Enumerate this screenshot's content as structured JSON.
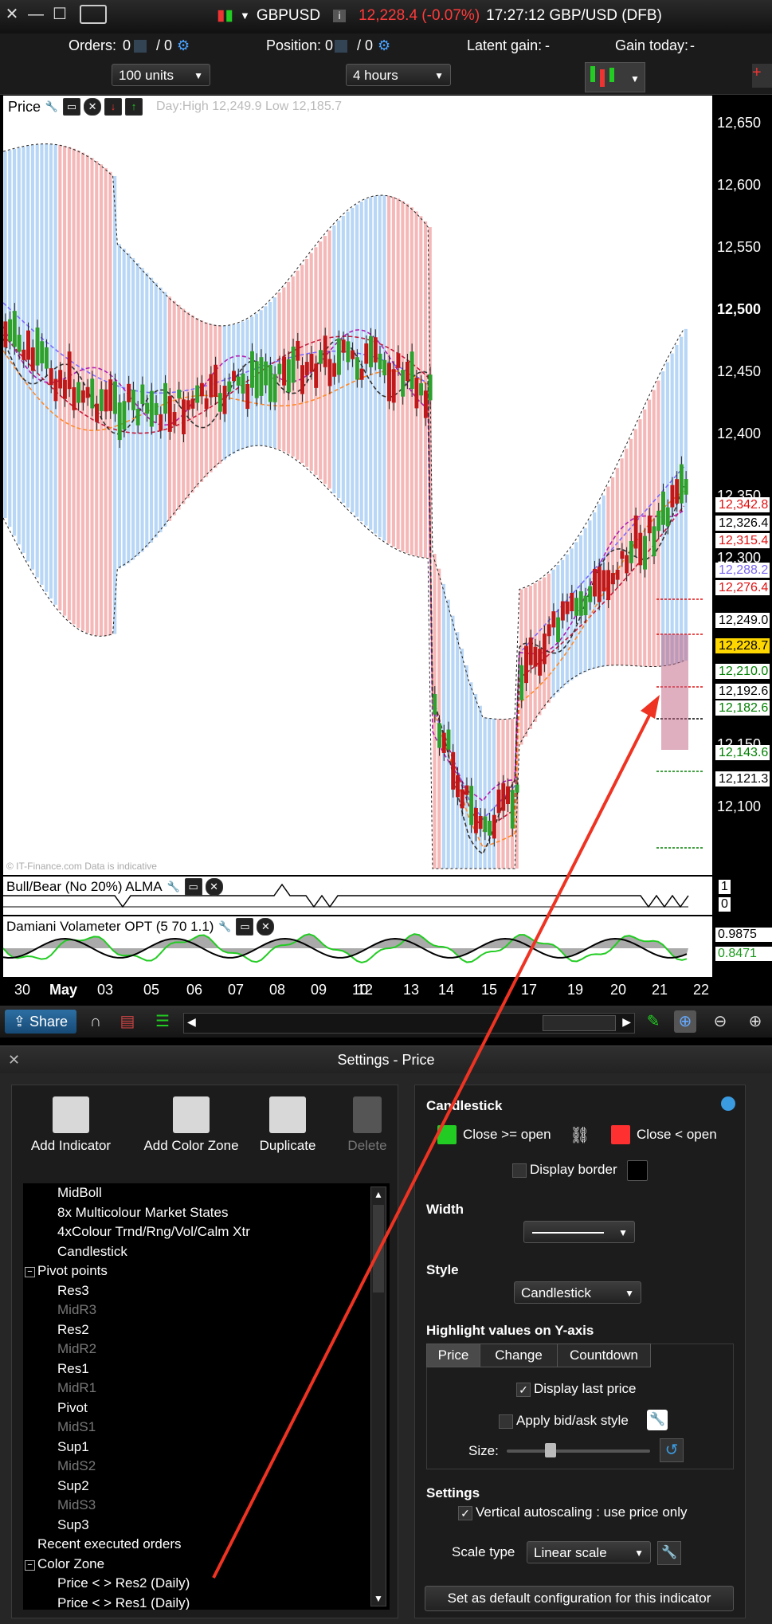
{
  "topbar": {
    "symbol": "GBPUSD",
    "price_change": "12,228.4 (-0.07%)",
    "time_name": "17:27:12 GBP/USD (DFB)",
    "info_icon": "info-icon"
  },
  "orderbar": {
    "orders_label": "Orders:",
    "orders_value": "0",
    "orders_slash": "/ 0",
    "position_label": "Position:",
    "position_value": "0",
    "position_slash": "/ 0",
    "latent_label": "Latent gain:",
    "latent_value": "-",
    "gain_label": "Gain today:",
    "gain_value": "-"
  },
  "selectors": {
    "units": "100 units",
    "timeframe": "4 hours"
  },
  "chart": {
    "title": "Price",
    "day_info": "Day:High 12,249.9 Low 12,185.7",
    "copyright": "© IT-Finance.com Data is indicative",
    "y_axis": [
      "12,650",
      "12,600",
      "12,550",
      "12,500",
      "12,450",
      "12,400",
      "12,350",
      "12,300",
      "12,150",
      "12,100"
    ],
    "price_tags": [
      {
        "text": "12,342.8",
        "color": "#e01010"
      },
      {
        "text": "12,326.4",
        "color": "#000000"
      },
      {
        "text": "12,315.4",
        "color": "#e01010"
      },
      {
        "text": "12,288.2",
        "color": "#7b68ee"
      },
      {
        "text": "12,276.4",
        "color": "#e01010"
      },
      {
        "text": "12,249.0",
        "color": "#000000"
      },
      {
        "text": "12,228.7",
        "color": "#000000"
      },
      {
        "text": "12,210.0",
        "color": "#008000"
      },
      {
        "text": "12,192.6",
        "color": "#000000"
      },
      {
        "text": "12,182.6",
        "color": "#008000"
      },
      {
        "text": "12,143.6",
        "color": "#008000"
      },
      {
        "text": "12,121.3",
        "color": "#000000"
      }
    ],
    "last_price_color": "#ffd700"
  },
  "indicator1": {
    "title": "Bull/Bear (No 20%) ALMA",
    "axis_1": "1",
    "axis_0": "0"
  },
  "indicator2": {
    "title": "Damiani Volameter OPT (5 70 1.1)",
    "val_black": "0.9875",
    "val_green": "0.8471"
  },
  "xaxis": [
    "30",
    "May",
    "03",
    "05",
    "06",
    "07",
    "08",
    "09",
    "10",
    "12",
    "13",
    "14",
    "15",
    "17",
    "19",
    "20",
    "21",
    "22"
  ],
  "toolbar": {
    "share_label": "Share"
  },
  "settings": {
    "title": "Settings - Price",
    "add_indicator": "Add Indicator",
    "add_color_zone": "Add Color Zone",
    "duplicate": "Duplicate",
    "delete": "Delete",
    "tree": [
      {
        "label": "MidBoll",
        "dim": false,
        "indent": 2
      },
      {
        "label": "8x Multicolour Market States",
        "dim": false,
        "indent": 2
      },
      {
        "label": "4xColour Trnd/Rng/Vol/Calm Xtr",
        "dim": false,
        "indent": 2
      },
      {
        "label": "Candlestick",
        "dim": false,
        "indent": 2
      },
      {
        "label": "Pivot points",
        "dim": false,
        "indent": 1,
        "toggle": "−"
      },
      {
        "label": "Res3",
        "dim": false,
        "indent": 2
      },
      {
        "label": "MidR3",
        "dim": true,
        "indent": 2
      },
      {
        "label": "Res2",
        "dim": false,
        "indent": 2
      },
      {
        "label": "MidR2",
        "dim": true,
        "indent": 2
      },
      {
        "label": "Res1",
        "dim": false,
        "indent": 2
      },
      {
        "label": "MidR1",
        "dim": true,
        "indent": 2
      },
      {
        "label": "Pivot",
        "dim": false,
        "indent": 2
      },
      {
        "label": "MidS1",
        "dim": true,
        "indent": 2
      },
      {
        "label": "Sup1",
        "dim": false,
        "indent": 2
      },
      {
        "label": "MidS2",
        "dim": true,
        "indent": 2
      },
      {
        "label": "Sup2",
        "dim": false,
        "indent": 2
      },
      {
        "label": "MidS3",
        "dim": true,
        "indent": 2
      },
      {
        "label": "Sup3",
        "dim": false,
        "indent": 2
      },
      {
        "label": "Recent executed orders",
        "dim": false,
        "indent": 1
      },
      {
        "label": "Color Zone",
        "dim": false,
        "indent": 1,
        "toggle": "−"
      },
      {
        "label": "Price < > Res2 (Daily)",
        "dim": false,
        "indent": 2
      },
      {
        "label": "Price < > Res1 (Daily)",
        "dim": false,
        "indent": 2
      }
    ],
    "candlestick_heading": "Candlestick",
    "close_ge_open": "Close >= open",
    "close_lt_open": "Close < open",
    "display_border": "Display border",
    "width_heading": "Width",
    "style_heading": "Style",
    "style_value": "Candlestick",
    "highlight_heading": "Highlight values on Y-axis",
    "tabs": [
      "Price",
      "Change",
      "Countdown"
    ],
    "display_last_price": "Display last price",
    "apply_bid_ask": "Apply bid/ask style",
    "size_label": "Size:",
    "settings_heading": "Settings",
    "vertical_autoscaling": "Vertical autoscaling : use price only",
    "scale_type_label": "Scale type",
    "scale_type_value": "Linear scale",
    "default_button": "Set as default configuration for this indicator",
    "colors": {
      "up": "#22cc22",
      "down": "#ff3030"
    }
  }
}
